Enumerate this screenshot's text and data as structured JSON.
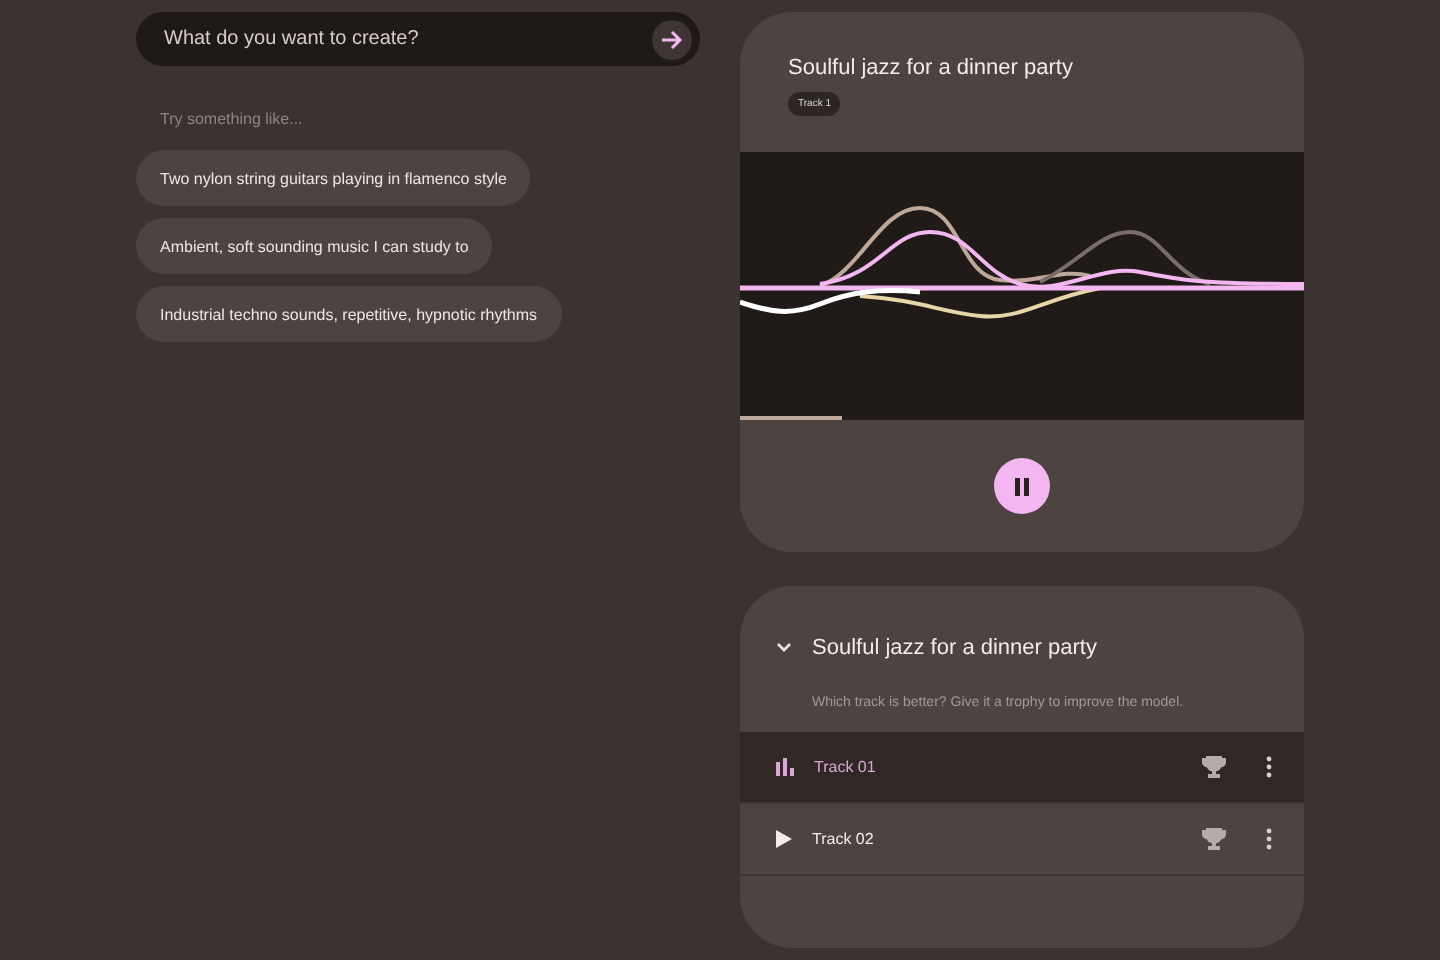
{
  "search": {
    "placeholder": "What do you want to create?"
  },
  "suggestions_label": "Try something like...",
  "suggestions": [
    "Two nylon string guitars playing in flamenco style",
    "Ambient, soft sounding music I can study to",
    "Industrial techno sounds, repetitive, hypnotic rhythms"
  ],
  "player": {
    "title": "Soulful jazz for a dinner party",
    "badge": "Track 1",
    "playing": true,
    "level": 0.18
  },
  "results": {
    "title": "Soulful jazz for a dinner party",
    "expanded": true,
    "hint": "Which track is better? Give it a trophy to improve the model.",
    "tracks": [
      {
        "label": "Track 01",
        "selected": true
      },
      {
        "label": "Track 02",
        "selected": false
      }
    ]
  }
}
